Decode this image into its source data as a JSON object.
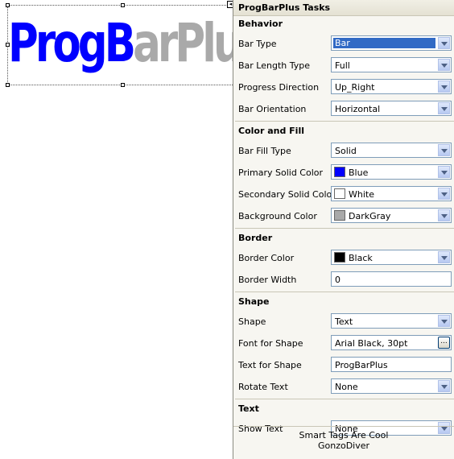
{
  "preview": {
    "text_filled": "ProgB",
    "text_rest": "arPlus",
    "fill_color": "#0000ff",
    "rest_color": "#a9a9a9"
  },
  "panel": {
    "title": "ProgBarPlus Tasks",
    "sections": {
      "behavior": {
        "title": "Behavior",
        "bar_type": {
          "label": "Bar Type",
          "value": "Bar"
        },
        "bar_length_type": {
          "label": "Bar Length Type",
          "value": "Full"
        },
        "progress_direction": {
          "label": "Progress Direction",
          "value": "Up_Right"
        },
        "bar_orientation": {
          "label": "Bar Orientation",
          "value": "Horizontal"
        }
      },
      "color_fill": {
        "title": "Color and Fill",
        "bar_fill_type": {
          "label": "Bar Fill Type",
          "value": "Solid"
        },
        "primary_solid_color": {
          "label": "Primary Solid Color",
          "value": "Blue",
          "swatch": "#0000ff"
        },
        "secondary_solid_color": {
          "label": "Secondary Solid Color",
          "value": "White",
          "swatch": "#ffffff"
        },
        "background_color": {
          "label": "Background Color",
          "value": "DarkGray",
          "swatch": "#a9a9a9"
        }
      },
      "border": {
        "title": "Border",
        "border_color": {
          "label": "Border Color",
          "value": "Black",
          "swatch": "#000000"
        },
        "border_width": {
          "label": "Border Width",
          "value": "0"
        }
      },
      "shape": {
        "title": "Shape",
        "shape": {
          "label": "Shape",
          "value": "Text"
        },
        "font_for_shape": {
          "label": "Font for Shape",
          "value": "Arial Black, 30pt",
          "button": "..."
        },
        "text_for_shape": {
          "label": "Text for Shape",
          "value": "ProgBarPlus"
        },
        "rotate_text": {
          "label": "Rotate Text",
          "value": "None"
        }
      },
      "text": {
        "title": "Text",
        "show_text": {
          "label": "Show Text",
          "value": "None"
        }
      }
    },
    "footer": {
      "line1": "Smart Tags Are Cool",
      "line2": "GonzoDiver"
    }
  }
}
